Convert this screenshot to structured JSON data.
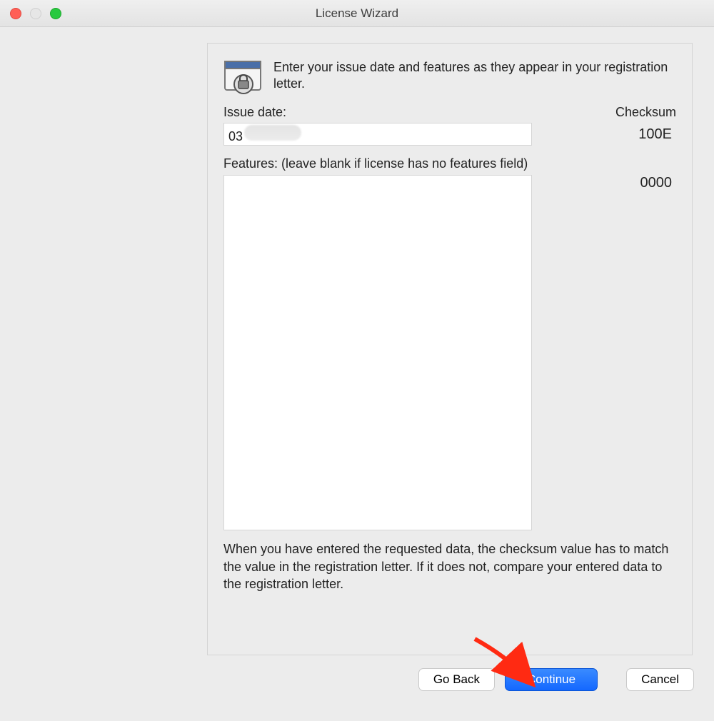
{
  "window": {
    "title": "License Wizard"
  },
  "headline": "Enter your issue date and features as they appear in your registration letter.",
  "labels": {
    "issue_date": "Issue date:",
    "checksum": "Checksum",
    "features": "Features: (leave blank if license has no features field)"
  },
  "fields": {
    "issue_date_value": "03",
    "issue_date_checksum": "100E",
    "features_value": "",
    "features_checksum": "0000"
  },
  "helptext": "When you have entered the requested data, the checksum value has to match the value in the registration letter.  If it does not, compare your entered data to the registration letter.",
  "buttons": {
    "go_back": "Go Back",
    "continue": "Continue",
    "cancel": "Cancel"
  }
}
